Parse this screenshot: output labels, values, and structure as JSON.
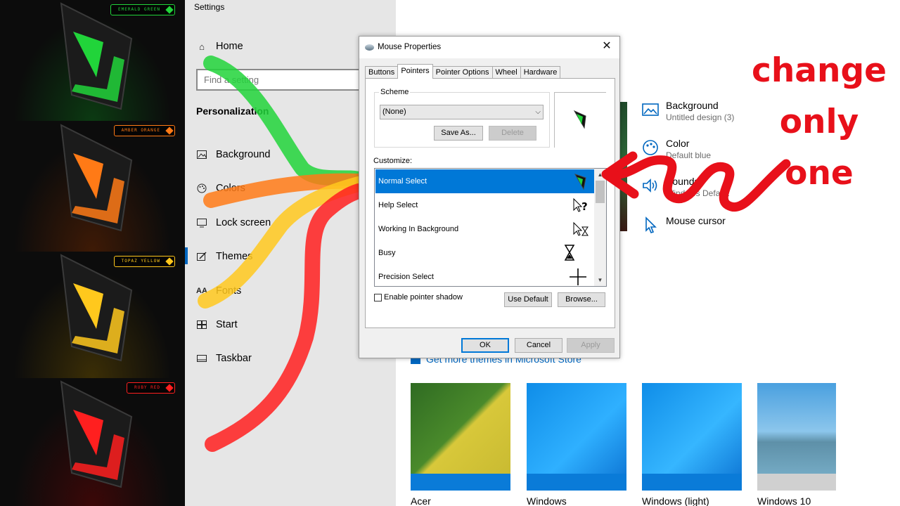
{
  "themes": [
    {
      "tag": "EMERALD GREEN",
      "color": "#21d43a",
      "glow": "#0c3a12"
    },
    {
      "tag": "AMBER ORANGE",
      "color": "#ff7a16",
      "glow": "#3e1a06"
    },
    {
      "tag": "TOPAZ YELLOW",
      "color": "#ffc81d",
      "glow": "#3b2e06"
    },
    {
      "tag": "RUBY RED",
      "color": "#ff1f1f",
      "glow": "#3b0808"
    }
  ],
  "settings": {
    "window_title": "Settings",
    "home": "Home",
    "search_placeholder": "Find a setting",
    "section": "Personalization",
    "nav": [
      "Background",
      "Colors",
      "Lock screen",
      "Themes",
      "Fonts",
      "Start",
      "Taskbar"
    ]
  },
  "content": {
    "options": [
      {
        "title": "Background",
        "sub": "Untitled design (3)",
        "icon": "image-icon"
      },
      {
        "title": "Color",
        "sub": "Default blue",
        "icon": "palette-icon"
      },
      {
        "title": "Sounds",
        "sub": "Windows Default",
        "icon": "speaker-icon"
      },
      {
        "title": "Mouse cursor",
        "sub": "",
        "icon": "cursor-icon"
      }
    ],
    "store_link": "Get more themes in Microsoft Store",
    "themes": [
      "Acer",
      "Windows",
      "Windows (light)",
      "Windows 10"
    ]
  },
  "dialog": {
    "title": "Mouse Properties",
    "tabs": [
      "Buttons",
      "Pointers",
      "Pointer Options",
      "Wheel",
      "Hardware"
    ],
    "active_tab": "Pointers",
    "scheme_label": "Scheme",
    "scheme_value": "(None)",
    "save_as": "Save As...",
    "delete": "Delete",
    "customize_label": "Customize:",
    "pointers": [
      "Normal Select",
      "Help Select",
      "Working In Background",
      "Busy",
      "Precision Select"
    ],
    "selected_pointer": "Normal Select",
    "shadow_label": "Enable pointer shadow",
    "use_default": "Use Default",
    "browse": "Browse...",
    "ok": "OK",
    "cancel": "Cancel",
    "apply": "Apply"
  },
  "annotation": {
    "lines": [
      "change",
      "only",
      "one"
    ],
    "color": "#e8101a"
  }
}
